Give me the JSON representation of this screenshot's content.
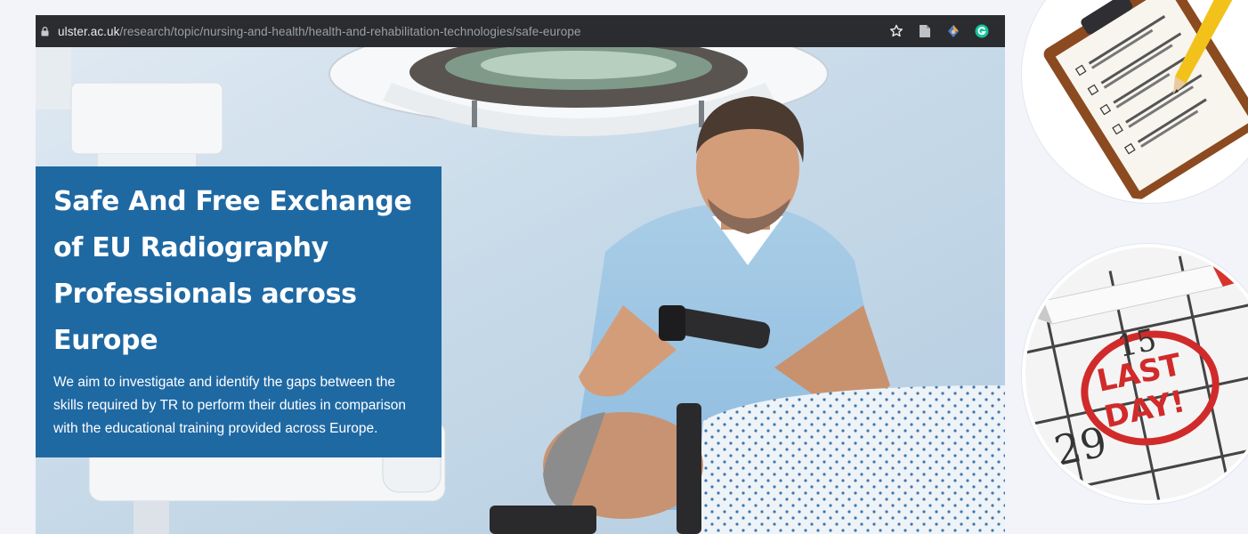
{
  "browser": {
    "url_domain": "ulster.ac.uk",
    "url_path": "/research/topic/nursing-and-health/health-and-rehabilitation-technologies/safe-europe",
    "icons": [
      "lock-icon",
      "star-icon",
      "reader-icon",
      "extension-icon",
      "grammarly-icon"
    ]
  },
  "hero": {
    "title": "Safe And Free Exchange of EU Radiography Professionals across Europe",
    "description": "We aim to investigate and identify the gaps between the skills required by TR to perform their duties in comparison with the educational training provided across Europe.",
    "colors": {
      "card": "#1f69a3",
      "text": "#ffffff"
    }
  },
  "side": {
    "checklist_image": "clipboard-checklist-illustration",
    "calendar_image": "calendar-last-day-illustration"
  }
}
